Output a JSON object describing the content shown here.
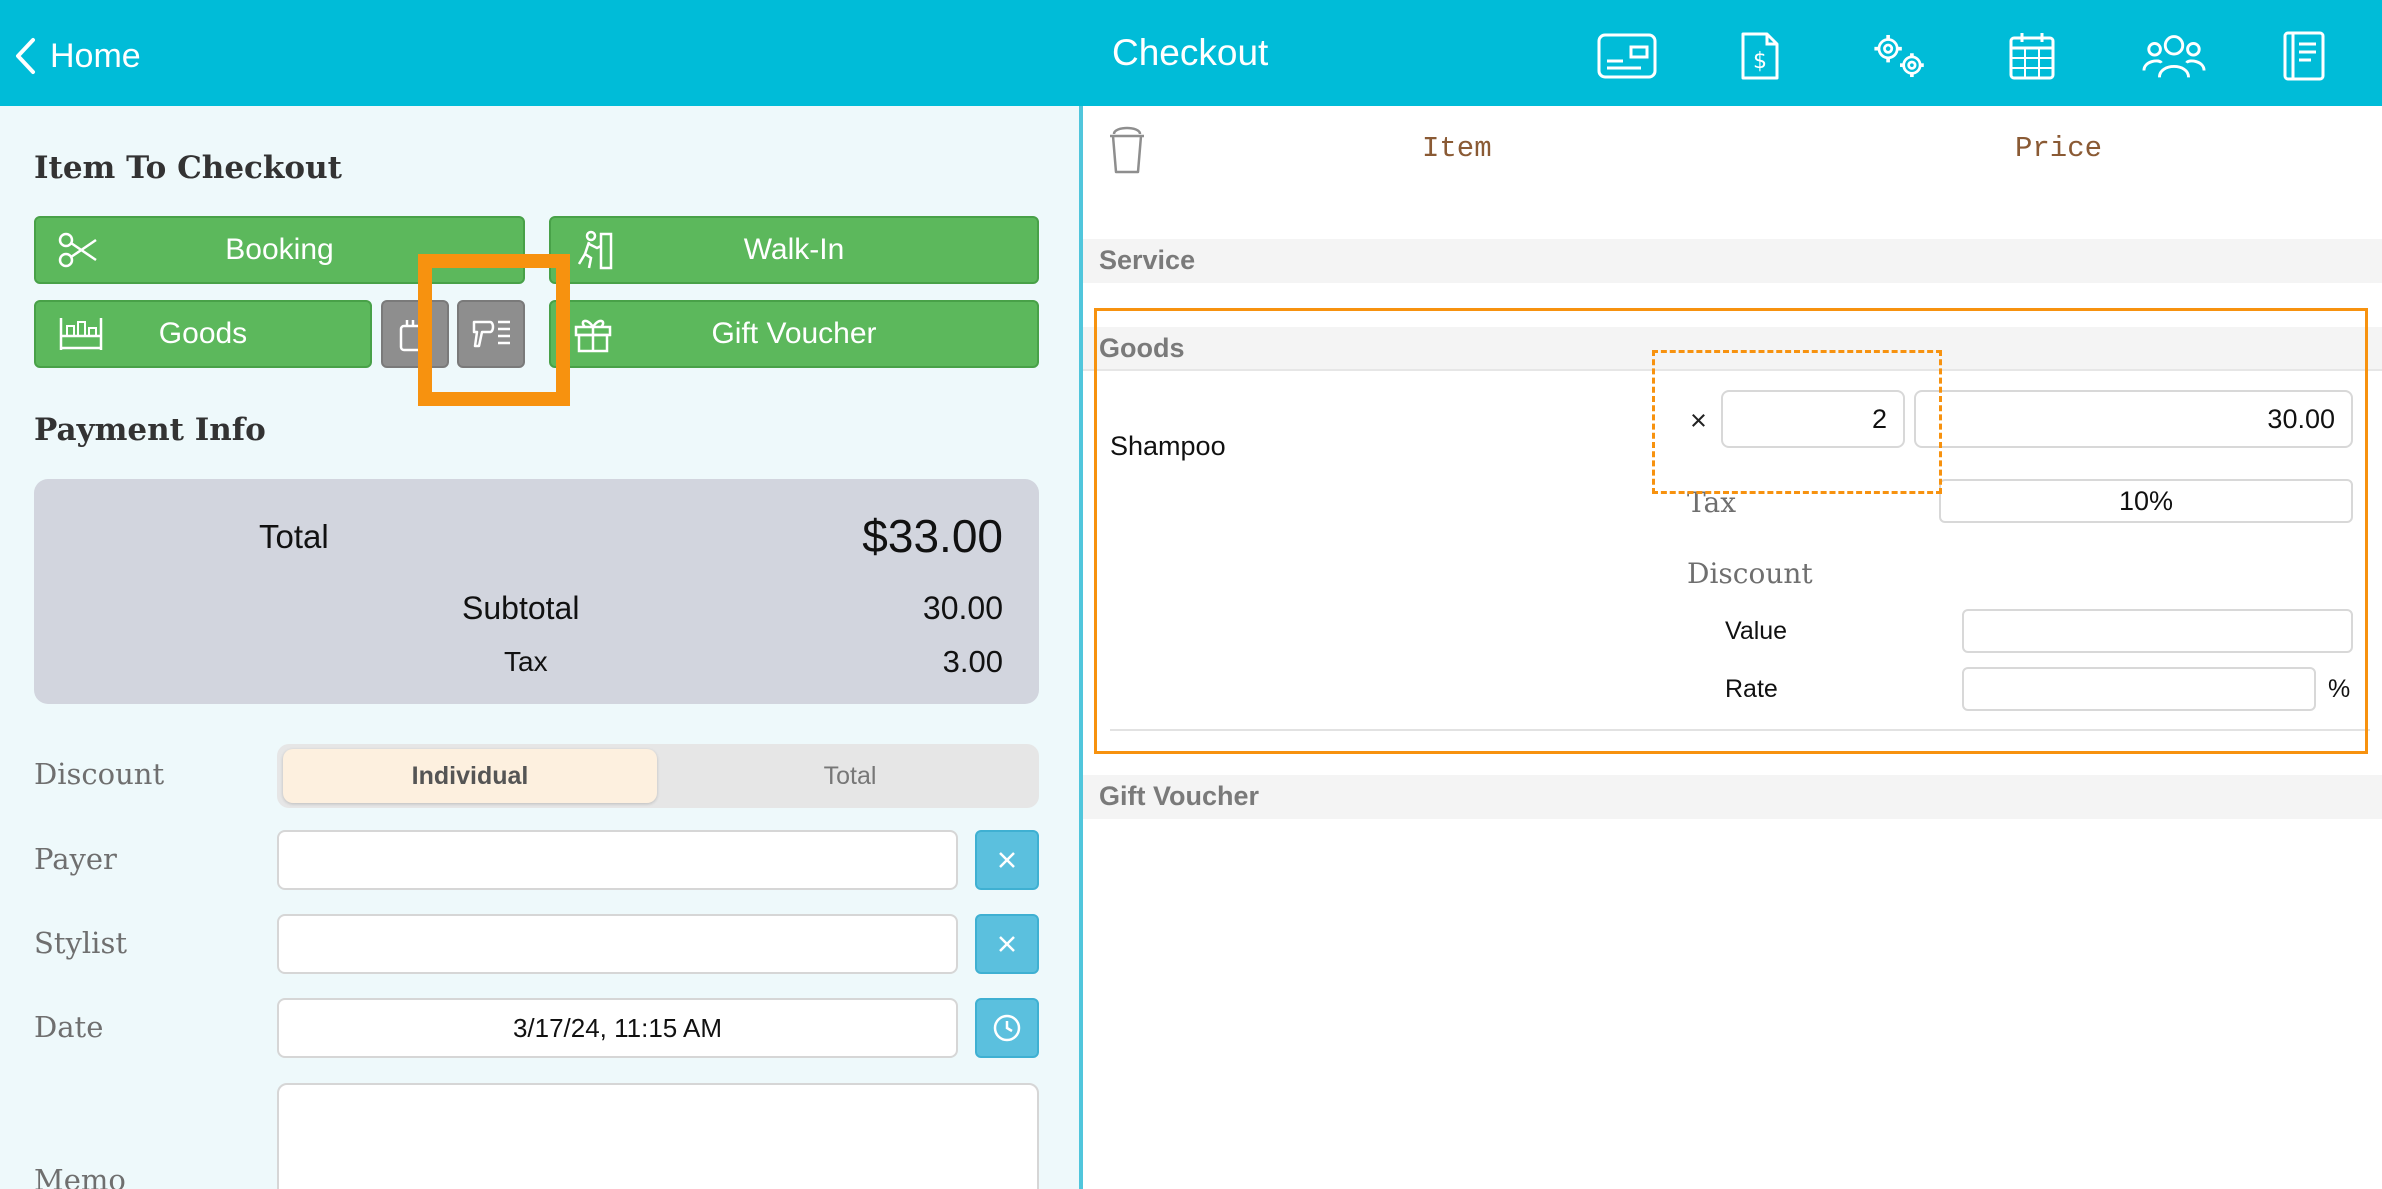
{
  "topbar": {
    "back_label": "Home",
    "title": "Checkout",
    "icons": [
      "card-icon",
      "invoice-dollar-icon",
      "settings-gears-icon",
      "calendar-icon",
      "users-icon",
      "ledger-book-icon"
    ],
    "bg_color": "#00bcd8"
  },
  "left": {
    "item_section_title": "Item To Checkout",
    "buttons": {
      "booking": "Booking",
      "walkin": "Walk-In",
      "goods": "Goods",
      "gift_voucher": "Gift Voucher"
    },
    "payment_section_title": "Payment Info",
    "summary": {
      "total_label": "Total",
      "total_value": "$33.00",
      "subtotal_label": "Subtotal",
      "subtotal_value": "30.00",
      "tax_label": "Tax",
      "tax_value": "3.00"
    },
    "form": {
      "discount_label": "Discount",
      "discount_options": [
        "Individual",
        "Total"
      ],
      "discount_selected": "Individual",
      "payer_label": "Payer",
      "payer_value": "",
      "stylist_label": "Stylist",
      "stylist_value": "",
      "date_label": "Date",
      "date_value": "3/17/24, 11:15 AM",
      "memo_label": "Memo",
      "memo_value": ""
    },
    "accent_green": "#5cb85c"
  },
  "right": {
    "headers": {
      "item": "Item",
      "price": "Price"
    },
    "sections": {
      "service": "Service",
      "goods": "Goods",
      "gift_voucher": "Gift Voucher"
    },
    "goods_items": [
      {
        "name": "Shampoo",
        "multiply_symbol": "×",
        "quantity": "2",
        "price": "30.00",
        "tax_label": "Tax",
        "tax_value": "10%",
        "discount_label": "Discount",
        "discount_value_label": "Value",
        "discount_value": "",
        "discount_rate_label": "Rate",
        "discount_rate": "",
        "percent_symbol": "%"
      }
    ],
    "highlight_color": "#f7920f"
  }
}
